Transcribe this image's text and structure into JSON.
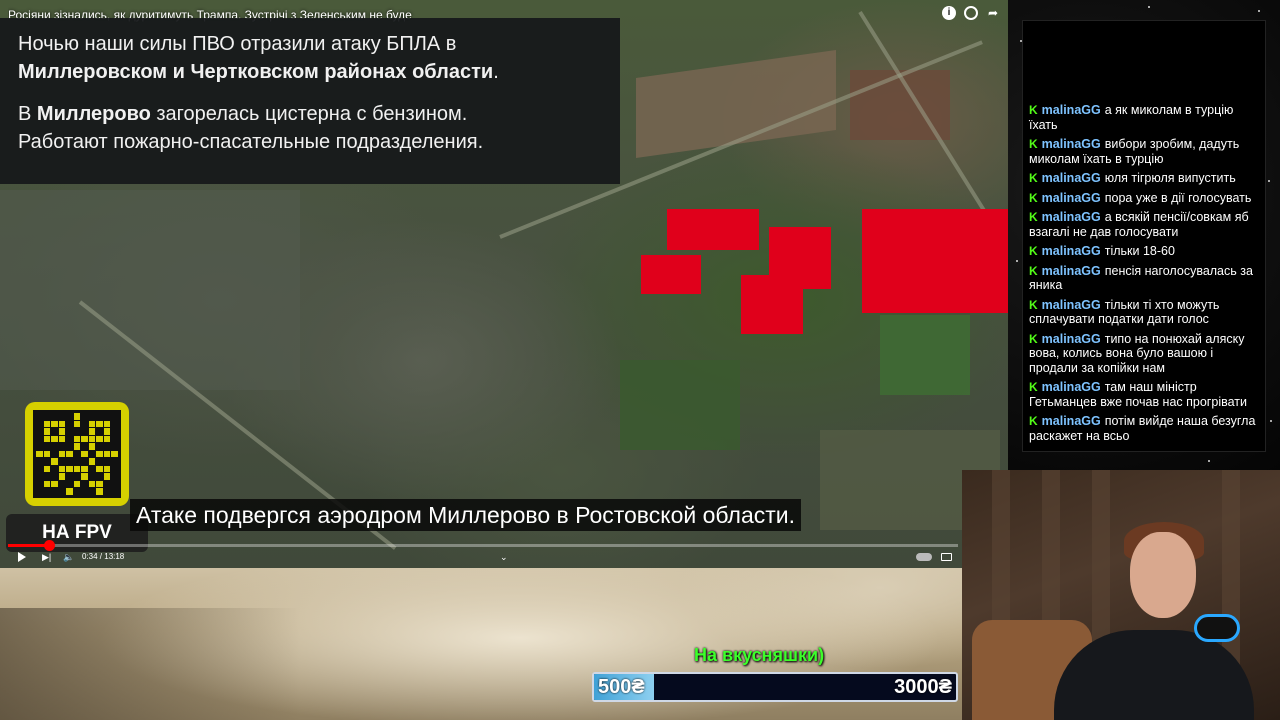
{
  "video": {
    "title": "Росіяни зізнались, як дуритимуть Трампа. Зустрічі з Зеленським не буде",
    "icons": [
      "info-icon",
      "clock-icon",
      "share-icon"
    ],
    "news": {
      "p1_line1": "Ночью наши силы ПВО отразили атаку БПЛА в",
      "p1_line2_bold": "Миллеровском и Чертковском районах области",
      "p1_line2_end": ".",
      "p2_prefix": "В ",
      "p2_bold": "Миллерово",
      "p2_rest": " загорелась цистерна с бензином.",
      "p2_line2": "Работают пожарно-спасательные подразделения."
    },
    "fpv_label": "НА FPV",
    "subtitle": "Атаке подвергся аэродром Миллерово в Ростовской области.",
    "player": {
      "time": "0:34 / 13:18",
      "progress_fraction": 0.043
    },
    "accent_red": "#e0001b"
  },
  "donation": {
    "label": "На вкусняшки)",
    "current": "500₴",
    "goal": "3000₴",
    "fill_fraction": 0.167
  },
  "chat": {
    "messages": [
      {
        "user": "malinaGG",
        "text": "а як миколам в турцію їхать"
      },
      {
        "user": "malinaGG",
        "text": "вибори зробим, дадуть миколам їхать в турцію"
      },
      {
        "user": "malinaGG",
        "text": "юля тігрюля випустить"
      },
      {
        "user": "malinaGG",
        "text": "пора уже в дії голосувать"
      },
      {
        "user": "malinaGG",
        "text": "а всякій пенсії/совкам яб взагалі не дав голосувати"
      },
      {
        "user": "malinaGG",
        "text": "тільки 18-60"
      },
      {
        "user": "malinaGG",
        "text": "пенсія наголосувалась за яника"
      },
      {
        "user": "malinaGG",
        "text": "тільки ті хто можуть сплачувати податки дати голос"
      },
      {
        "user": "malinaGG",
        "text": "типо на понюхай аляску вова, колись вона було вашою і продали за копійки нам"
      },
      {
        "user": "malinaGG",
        "text": "там наш міністр Гетьманцев вже почав нас прогрівати"
      },
      {
        "user": "malinaGG",
        "text": "потім вийде наша безугла раскажет на всьо"
      }
    ],
    "badge_color": "#53fc18",
    "user_color": "#7ec3ff"
  }
}
